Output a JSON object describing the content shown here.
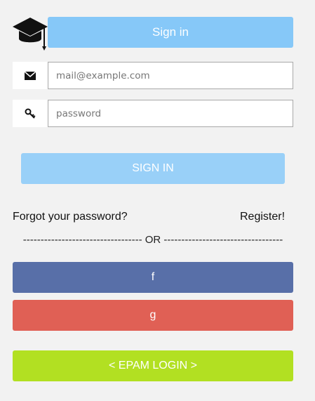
{
  "header": {
    "sign_in_label": "Sign in"
  },
  "email": {
    "placeholder": "mail@example.com"
  },
  "password": {
    "placeholder": "password"
  },
  "actions": {
    "sign_in_button": "SIGN IN",
    "forgot_password": "Forgot your password?",
    "register": "Register!"
  },
  "divider": {
    "text": "---------------------------------- OR ----------------------------------"
  },
  "social": {
    "facebook_label": "f",
    "google_label": "g",
    "epam_label": "< EPAM LOGIN >"
  },
  "colors": {
    "header_button": "#86c8f8",
    "sign_in_button": "#99d0f8",
    "facebook": "#586fa8",
    "google": "#e06055",
    "epam": "#b2e022",
    "background": "#f2f2f2"
  },
  "icons": {
    "logo": "graduation-cap-icon",
    "email": "envelope-icon",
    "password": "key-icon"
  }
}
